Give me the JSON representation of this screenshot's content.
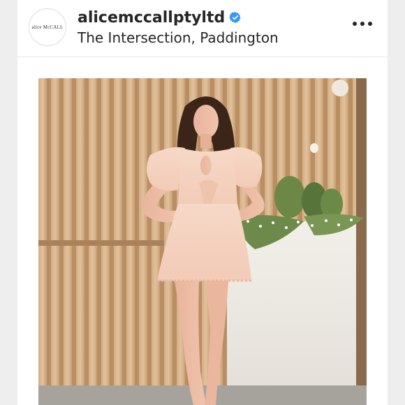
{
  "post": {
    "avatar_logo": "alice McCALL",
    "username": "alicemccallptyltd",
    "verified": true,
    "location": "The Intersection, Paddington",
    "icons": {
      "verified": "verified-badge-icon",
      "more": "more-options-icon"
    },
    "colors": {
      "verified_blue": "#3897f0",
      "text": "#262626"
    }
  }
}
